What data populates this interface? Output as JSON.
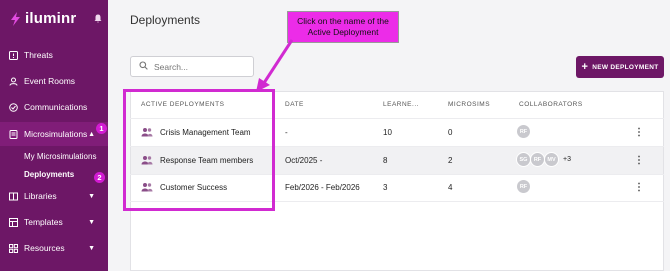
{
  "app": {
    "name": "iluminr"
  },
  "sidebar": {
    "items": [
      {
        "label": "Threats"
      },
      {
        "label": "Event Rooms"
      },
      {
        "label": "Communications"
      },
      {
        "label": "Microsimulations"
      },
      {
        "label": "Libraries"
      },
      {
        "label": "Templates"
      },
      {
        "label": "Resources"
      }
    ],
    "sub_items": [
      {
        "label": "My Microsimulations"
      },
      {
        "label": "Deployments"
      }
    ],
    "badges": [
      "1",
      "2"
    ]
  },
  "page": {
    "title": "Deployments"
  },
  "search": {
    "placeholder": "Search..."
  },
  "new_button": {
    "label": "NEW DEPLOYMENT"
  },
  "table": {
    "columns": [
      "ACTIVE DEPLOYMENTS",
      "DATE",
      "LEARNE...",
      "MICROSIMS",
      "COLLABORATORS"
    ],
    "rows": [
      {
        "name": "Crisis Management Team",
        "date": "-",
        "learners": "10",
        "microsims": "0",
        "collaborators": [
          "RF"
        ],
        "extra": ""
      },
      {
        "name": "Response Team members",
        "date": "Oct/2025 -",
        "learners": "8",
        "microsims": "2",
        "collaborators": [
          "SG",
          "RF",
          "MV"
        ],
        "extra": "+3"
      },
      {
        "name": "Customer Success",
        "date": "Feb/2026 - Feb/2026",
        "learners": "3",
        "microsims": "4",
        "collaborators": [
          "RF"
        ],
        "extra": ""
      }
    ],
    "more_glyph": "⋮"
  },
  "annotation": {
    "callout": "Click on the name of the Active Deployment"
  },
  "colors": {
    "brand": "#6d1766",
    "annotation": "#d12ad1",
    "callout_bg": "#ec2ce8"
  }
}
